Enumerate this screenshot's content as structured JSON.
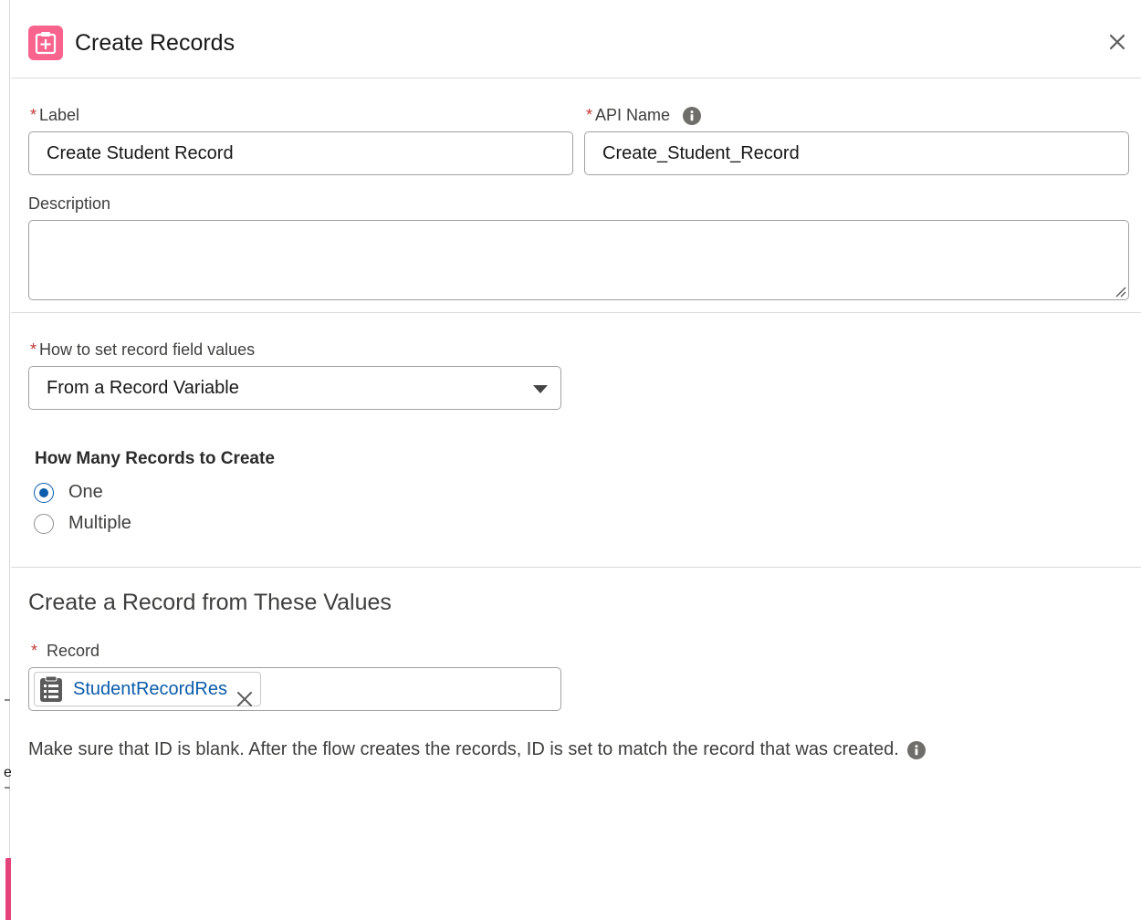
{
  "header": {
    "title": "Create Records",
    "icon": "create-records-icon",
    "close_icon": "close-icon",
    "accent_color": "#f8648e"
  },
  "fields": {
    "label": {
      "label": "Label",
      "required_mark": "*",
      "value": "Create Student Record"
    },
    "api_name": {
      "label": "API Name",
      "required_mark": "*",
      "value": "Create_Student_Record",
      "info_icon": "info-icon"
    },
    "description": {
      "label": "Description",
      "value": ""
    }
  },
  "field_values": {
    "label": "How to set record field values",
    "required_mark": "*",
    "selected": "From a Record Variable"
  },
  "how_many": {
    "heading": "How Many Records to Create",
    "options": [
      {
        "label": "One",
        "checked": true
      },
      {
        "label": "Multiple",
        "checked": false
      }
    ]
  },
  "record_section": {
    "title": "Create a Record from These Values",
    "record_label": "Record",
    "required_mark": "*",
    "pill_label": "StudentRecordRes",
    "pill_icon": "record-variable-icon",
    "help_text": "Make sure that ID is blank. After the flow creates the records, ID is set to match the record that was created."
  },
  "backdrop": {
    "edge_char": "e",
    "accent_color": "#e3427b"
  },
  "colors": {
    "required": "#c23934",
    "link": "#0b5cab",
    "border": "#a0a0a0"
  }
}
